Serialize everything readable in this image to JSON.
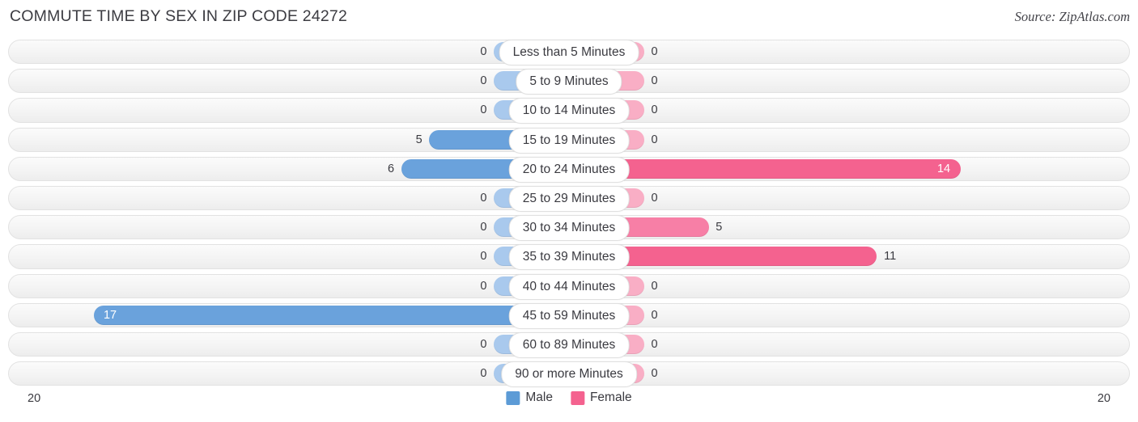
{
  "header": {
    "title": "COMMUTE TIME BY SEX IN ZIP CODE 24272",
    "source": "Source: ZipAtlas.com"
  },
  "legend": {
    "male_label": "Male",
    "female_label": "Female",
    "male_color": "#5c9bd6",
    "female_color": "#f4628f"
  },
  "axis": {
    "left_max": "20",
    "right_max": "20"
  },
  "chart_data": {
    "type": "bar",
    "title": "COMMUTE TIME BY SEX IN ZIP CODE 24272",
    "subtitle": "Source: ZipAtlas.com",
    "orientation": "horizontal-diverging",
    "xlabel": "",
    "ylabel": "",
    "xlim": [
      20,
      20
    ],
    "grid": false,
    "legend_position": "bottom-center",
    "categories": [
      "Less than 5 Minutes",
      "5 to 9 Minutes",
      "10 to 14 Minutes",
      "15 to 19 Minutes",
      "20 to 24 Minutes",
      "25 to 29 Minutes",
      "30 to 34 Minutes",
      "35 to 39 Minutes",
      "40 to 44 Minutes",
      "45 to 59 Minutes",
      "60 to 89 Minutes",
      "90 or more Minutes"
    ],
    "series": [
      {
        "name": "Male",
        "values": [
          0,
          0,
          0,
          5,
          6,
          0,
          0,
          0,
          0,
          17,
          0,
          0
        ]
      },
      {
        "name": "Female",
        "values": [
          0,
          0,
          0,
          0,
          14,
          0,
          5,
          11,
          0,
          0,
          0,
          0
        ]
      }
    ]
  },
  "rows": [
    {
      "label": "Less than 5 Minutes",
      "male": "0",
      "female": "0",
      "male_pct": 0,
      "female_pct": 0,
      "male_inside": false,
      "female_inside": false
    },
    {
      "label": "5 to 9 Minutes",
      "male": "0",
      "female": "0",
      "male_pct": 0,
      "female_pct": 0,
      "male_inside": false,
      "female_inside": false
    },
    {
      "label": "10 to 14 Minutes",
      "male": "0",
      "female": "0",
      "male_pct": 0,
      "female_pct": 0,
      "male_inside": false,
      "female_inside": false
    },
    {
      "label": "15 to 19 Minutes",
      "male": "5",
      "female": "0",
      "male_pct": 25,
      "female_pct": 0,
      "male_inside": false,
      "female_inside": false
    },
    {
      "label": "20 to 24 Minutes",
      "male": "6",
      "female": "14",
      "male_pct": 30,
      "female_pct": 70,
      "male_inside": false,
      "female_inside": true
    },
    {
      "label": "25 to 29 Minutes",
      "male": "0",
      "female": "0",
      "male_pct": 0,
      "female_pct": 0,
      "male_inside": false,
      "female_inside": false
    },
    {
      "label": "30 to 34 Minutes",
      "male": "0",
      "female": "5",
      "male_pct": 0,
      "female_pct": 25,
      "male_inside": false,
      "female_inside": false
    },
    {
      "label": "35 to 39 Minutes",
      "male": "0",
      "female": "11",
      "male_pct": 0,
      "female_pct": 55,
      "male_inside": false,
      "female_inside": false
    },
    {
      "label": "40 to 44 Minutes",
      "male": "0",
      "female": "0",
      "male_pct": 0,
      "female_pct": 0,
      "male_inside": false,
      "female_inside": false
    },
    {
      "label": "45 to 59 Minutes",
      "male": "17",
      "female": "0",
      "male_pct": 85,
      "female_pct": 0,
      "male_inside": true,
      "female_inside": false
    },
    {
      "label": "60 to 89 Minutes",
      "male": "0",
      "female": "0",
      "male_pct": 0,
      "female_pct": 0,
      "male_inside": false,
      "female_inside": false
    },
    {
      "label": "90 or more Minutes",
      "male": "0",
      "female": "0",
      "male_pct": 0,
      "female_pct": 0,
      "male_inside": false,
      "female_inside": false
    }
  ]
}
